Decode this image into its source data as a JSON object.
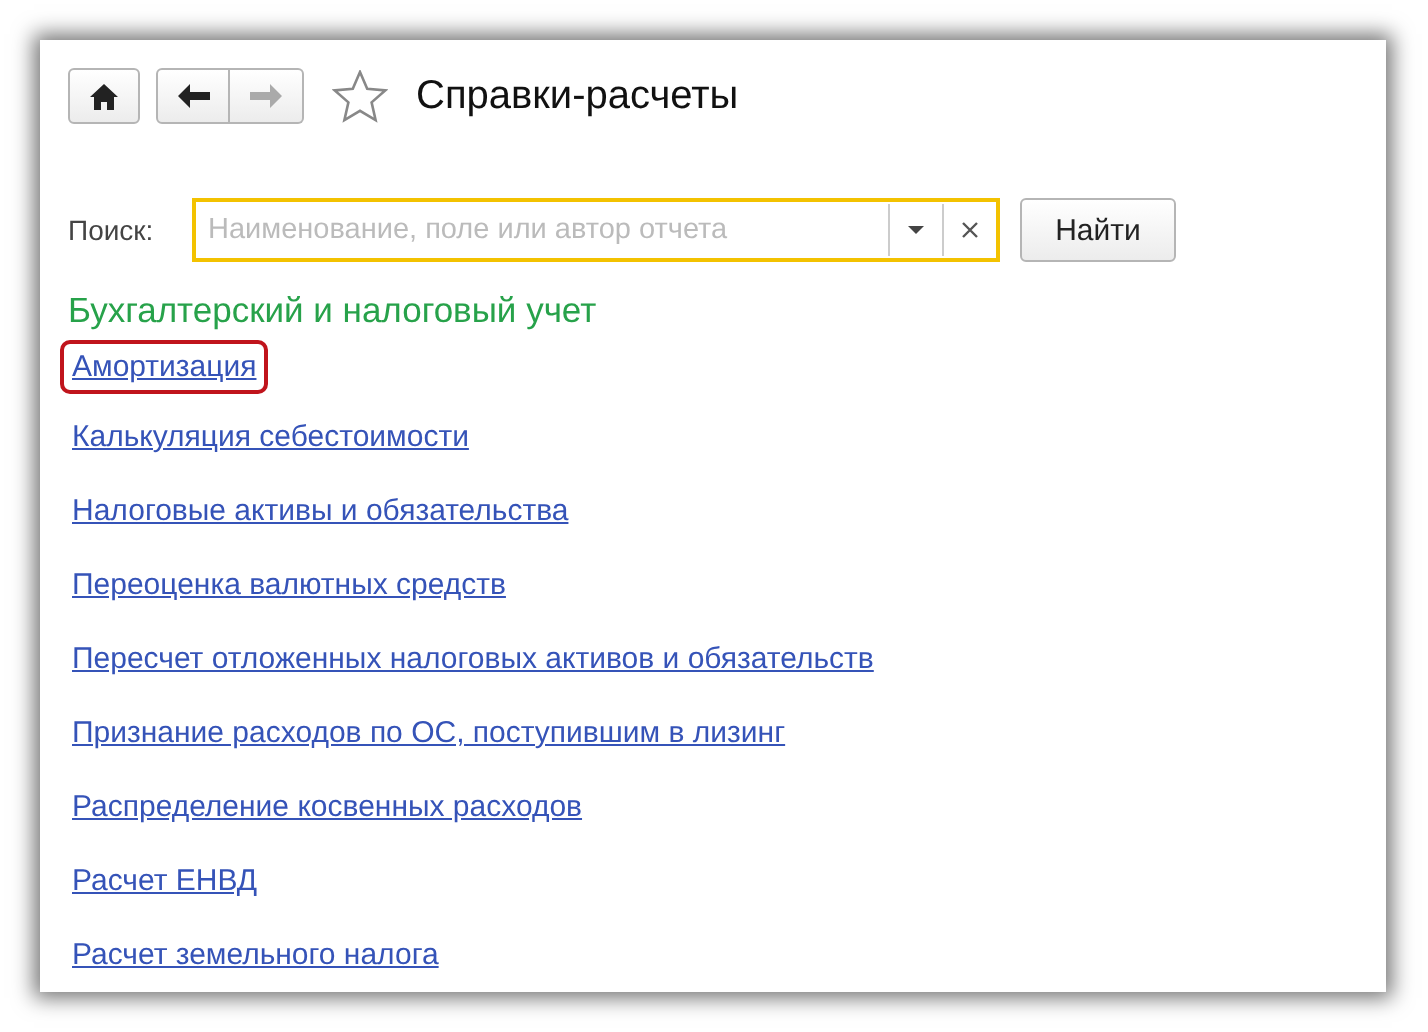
{
  "window": {
    "title": "Справки-расчеты",
    "favorite": false
  },
  "nav": {
    "back": {
      "disabled": false
    },
    "forward": {
      "disabled": true
    }
  },
  "search": {
    "label": "Поиск:",
    "placeholder": "Наименование, поле или автор отчета",
    "focused": true,
    "button": "Найти"
  },
  "section": {
    "title": "Бухгалтерский и налоговый учет",
    "links": [
      {
        "label": "Амортизация",
        "highlighted": true
      },
      {
        "label": "Калькуляция себестоимости",
        "highlighted": false
      },
      {
        "label": "Налоговые активы и обязательства",
        "highlighted": false
      },
      {
        "label": "Переоценка валютных средств",
        "highlighted": false
      },
      {
        "label": "Пересчет отложенных налоговых активов и обязательств",
        "highlighted": false
      },
      {
        "label": "Признание расходов по ОС, поступившим в лизинг",
        "highlighted": false
      },
      {
        "label": "Распределение косвенных расходов",
        "highlighted": false
      },
      {
        "label": "Расчет ЕНВД",
        "highlighted": false
      },
      {
        "label": "Расчет земельного налога",
        "highlighted": false
      }
    ]
  }
}
